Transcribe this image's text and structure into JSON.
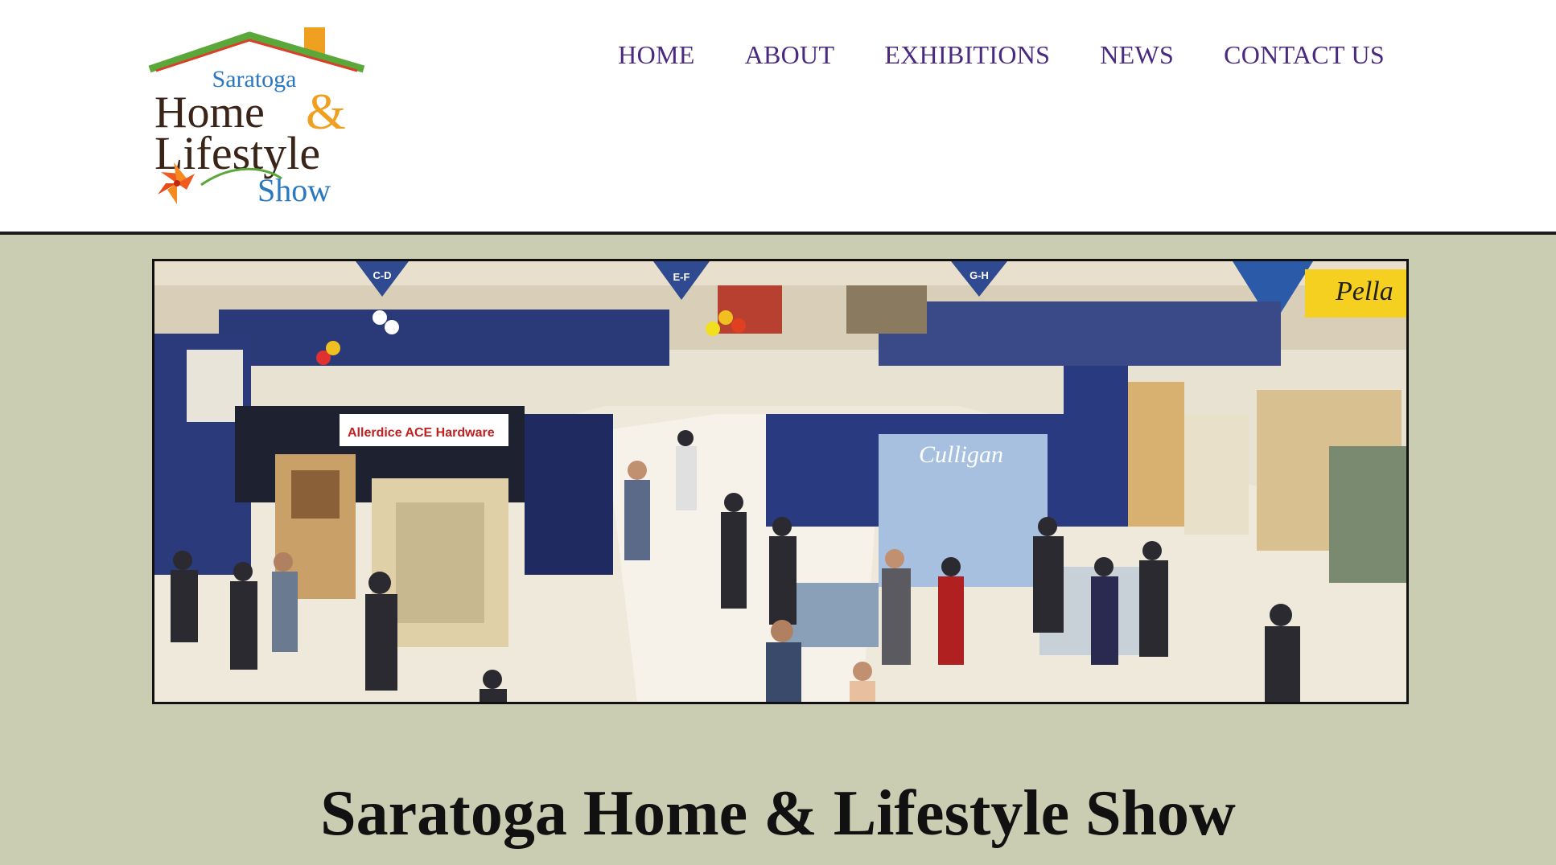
{
  "logo": {
    "line1": "Saratoga",
    "line2": "Home",
    "amp": "&",
    "line3": "Lifestyle",
    "line4": "Show"
  },
  "nav": {
    "items": [
      {
        "label": "HOME"
      },
      {
        "label": "ABOUT"
      },
      {
        "label": "EXHIBITIONS"
      },
      {
        "label": "NEWS"
      },
      {
        "label": "CONTACT US"
      }
    ]
  },
  "hero": {
    "banner_1": "C-D",
    "banner_2": "E-F",
    "banner_3": "G-H",
    "sign_ace": "Allerdice ACE Hardware",
    "sign_culligan": "Culligan",
    "sign_pella": "Pella"
  },
  "main": {
    "title": "Saratoga Home & Lifestyle Show"
  },
  "colors": {
    "nav_text": "#4a2a80",
    "page_background": "#cbcdb3",
    "logo_roof_green": "#5aa83a",
    "logo_roof_red": "#d8402a",
    "logo_chimney": "#f0a020",
    "logo_blue": "#2a78c0",
    "logo_dark": "#3a2418"
  }
}
